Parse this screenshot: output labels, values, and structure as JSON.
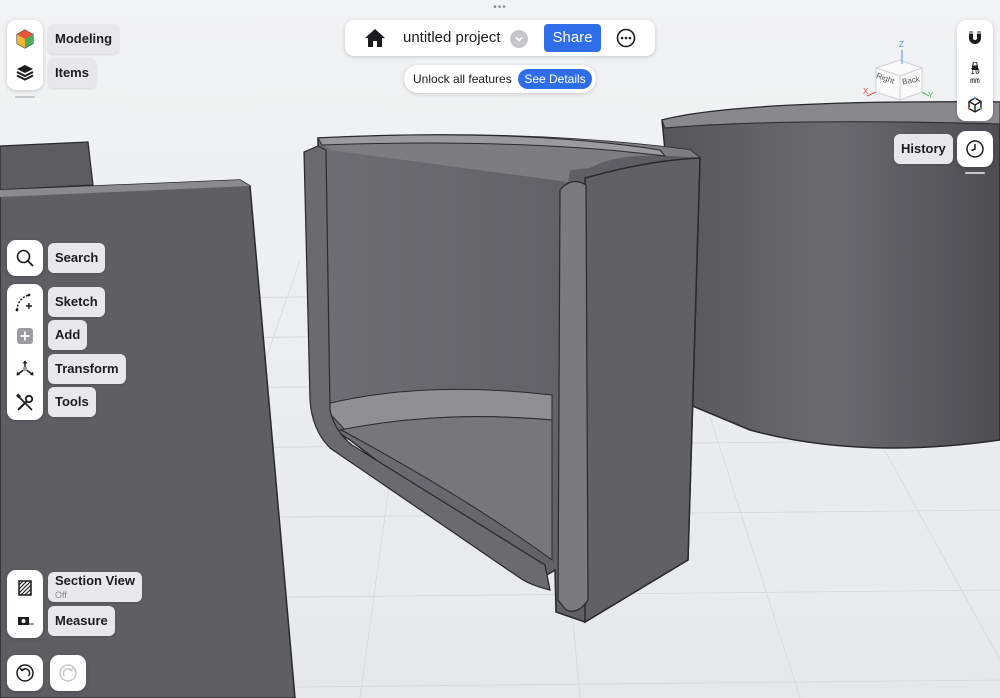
{
  "top_menu": {
    "dots": "•••"
  },
  "left_top": {
    "modeling_label": "Modeling",
    "items_label": "Items"
  },
  "toolbar": {
    "project_title": "untitled project",
    "share_label": "Share"
  },
  "promo": {
    "text": "Unlock all features",
    "button_label": "See Details"
  },
  "right_panel": {
    "snap_value": "10",
    "snap_unit": "mm",
    "history_label": "History"
  },
  "view_cube": {
    "z": "Z",
    "x": "X",
    "y": "Y",
    "right_face": "Right",
    "back_face": "Back"
  },
  "left_tools": {
    "search": "Search",
    "sketch": "Sketch",
    "add": "Add",
    "transform": "Transform",
    "tools": "Tools"
  },
  "bottom_tools": {
    "section_view": "Section View",
    "section_view_state": "Off",
    "measure": "Measure"
  },
  "icons": {
    "modeling": "cube-color-icon",
    "items": "layers-icon",
    "home": "home-icon",
    "dropdown": "chevron-down-icon",
    "more": "ellipsis-circle-icon",
    "magnet": "magnet-icon",
    "lock": "lock-icon",
    "cube_snap": "cube-snap-icon",
    "history": "clock-icon",
    "search": "search-icon",
    "sketch": "sketch-arc-icon",
    "add": "plus-square-icon",
    "transform": "transform-axes-icon",
    "tools": "wrench-screwdriver-icon",
    "section_view": "section-hatch-icon",
    "measure": "tape-measure-icon",
    "undo": "undo-icon",
    "redo": "redo-icon"
  },
  "colors": {
    "accent": "#2f6ee8",
    "background": "#eef0f2",
    "model_gray": "#5b5b5f"
  }
}
